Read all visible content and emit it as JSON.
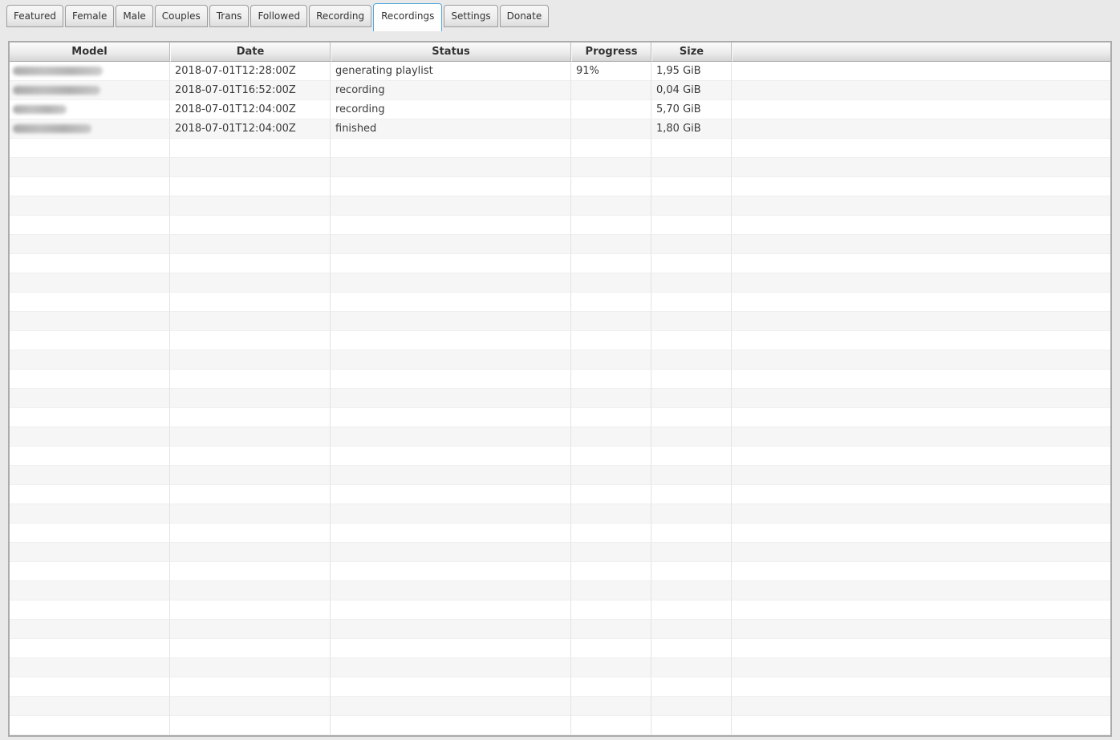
{
  "tabs": {
    "items": [
      {
        "label": "Featured",
        "active": false
      },
      {
        "label": "Female",
        "active": false
      },
      {
        "label": "Male",
        "active": false
      },
      {
        "label": "Couples",
        "active": false
      },
      {
        "label": "Trans",
        "active": false
      },
      {
        "label": "Followed",
        "active": false
      },
      {
        "label": "Recording",
        "active": false
      },
      {
        "label": "Recordings",
        "active": true
      },
      {
        "label": "Settings",
        "active": false
      },
      {
        "label": "Donate",
        "active": false
      }
    ]
  },
  "table": {
    "columns": [
      "Model",
      "Date",
      "Status",
      "Progress",
      "Size",
      ""
    ],
    "rows": [
      {
        "model": "",
        "model_redacted": true,
        "blur_width": 112,
        "date": "2018-07-01T12:28:00Z",
        "status": "generating playlist",
        "progress": "91%",
        "size": "1,95 GiB"
      },
      {
        "model": "",
        "model_redacted": true,
        "blur_width": 109,
        "date": "2018-07-01T16:52:00Z",
        "status": "recording",
        "progress": "",
        "size": "0,04 GiB"
      },
      {
        "model": "",
        "model_redacted": true,
        "blur_width": 67,
        "date": "2018-07-01T12:04:00Z",
        "status": "recording",
        "progress": "",
        "size": "5,70 GiB"
      },
      {
        "model": "",
        "model_redacted": true,
        "blur_width": 98,
        "date": "2018-07-01T12:04:00Z",
        "status": "finished",
        "progress": "",
        "size": "1,80 GiB"
      }
    ],
    "empty_row_count": 31
  },
  "colors": {
    "accent_tab_border": "#53aad6",
    "page_background": "#e9e9e9",
    "row_stripe": "#f6f6f7",
    "table_border": "#ababab",
    "header_text": "#333333"
  }
}
